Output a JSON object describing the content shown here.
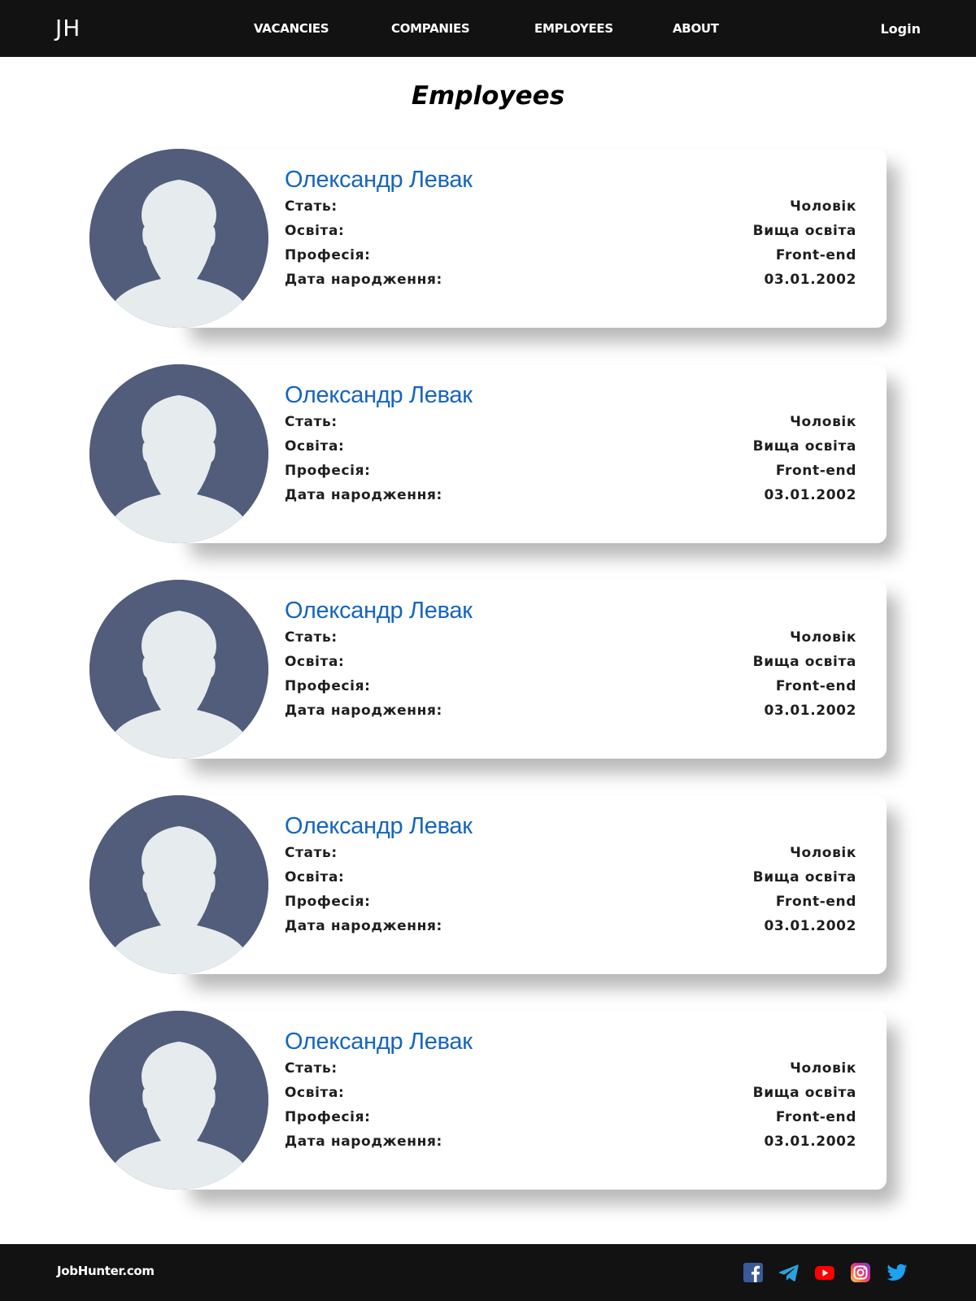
{
  "header": {
    "logo": "JH",
    "nav": [
      "VACANCIES",
      "COMPANIES",
      "EMPLOYEES",
      "ABOUT"
    ],
    "login": "Login"
  },
  "page_title": "Employees",
  "labels": {
    "gender": "Стать:",
    "education": "Освіта:",
    "profession": "Професія:",
    "birthdate": "Дата народження:"
  },
  "employees": [
    {
      "name": "Олександр Левак",
      "gender": "Чоловік",
      "education": "Вища освіта",
      "profession": "Front-end",
      "birthdate": "03.01.2002"
    },
    {
      "name": "Олександр Левак",
      "gender": "Чоловік",
      "education": "Вища освіта",
      "profession": "Front-end",
      "birthdate": "03.01.2002"
    },
    {
      "name": "Олександр Левак",
      "gender": "Чоловік",
      "education": "Вища освіта",
      "profession": "Front-end",
      "birthdate": "03.01.2002"
    },
    {
      "name": "Олександр Левак",
      "gender": "Чоловік",
      "education": "Вища освіта",
      "profession": "Front-end",
      "birthdate": "03.01.2002"
    },
    {
      "name": "Олександр Левак",
      "gender": "Чоловік",
      "education": "Вища освіта",
      "profession": "Front-end",
      "birthdate": "03.01.2002"
    }
  ],
  "footer": {
    "brand": "JobHunter.com",
    "social_icons": [
      "facebook-icon",
      "telegram-icon",
      "youtube-icon",
      "instagram-icon",
      "twitter-icon"
    ]
  },
  "colors": {
    "header_bg": "#121212",
    "name_accent": "#1565c0",
    "avatar_bg": "#525d7c",
    "avatar_figure": "#e6ecee"
  }
}
